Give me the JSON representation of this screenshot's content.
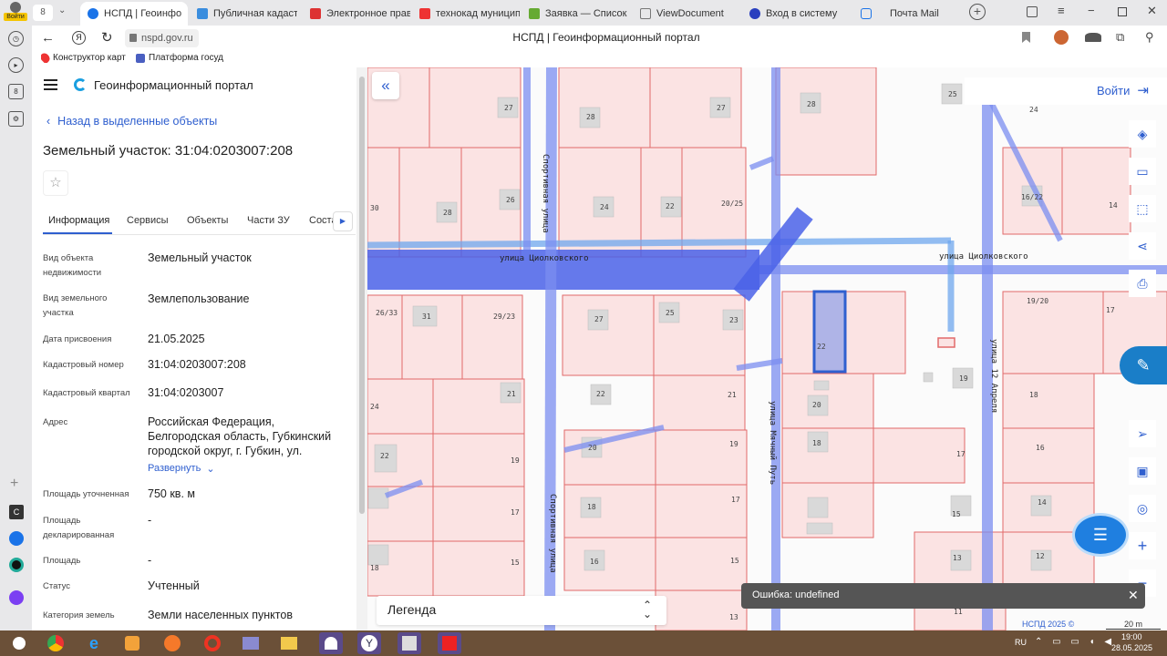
{
  "browser": {
    "tabs": [
      {
        "label": "НСПД | Геоинфо",
        "color": "#1a73e8"
      },
      {
        "label": "Публичная кадастр",
        "color": "#3a8dde"
      },
      {
        "label": "Электронное прави",
        "color": "#d33"
      },
      {
        "label": "технокад муниципа",
        "color": "#e33"
      },
      {
        "label": "Заявка — Список за",
        "color": "#6a3"
      },
      {
        "label": "ViewDocument",
        "color": "#777"
      },
      {
        "label": "Вход в систему",
        "color": "#2a3fbf"
      },
      {
        "label": "Почта Mail",
        "color": "#1a73e8"
      }
    ],
    "first_tab_badge": "8",
    "profile_label": "Войти",
    "url": "nspd.gov.ru",
    "page_title": "НСПД | Геоинформационный портал",
    "bookmarks": [
      "Конструктор карт",
      "Платформа госуд"
    ]
  },
  "sidebar": {
    "badge": "8"
  },
  "panel": {
    "app_title": "Геоинформационный портал",
    "back_link": "Назад в выделенные объекты",
    "object_title": "Земельный участок: 31:04:0203007:208",
    "tabs": [
      "Информация",
      "Сервисы",
      "Объекты",
      "Части ЗУ",
      "Соста"
    ],
    "rows": [
      {
        "label": "Вид объекта недвижимости",
        "value": "Земельный участок"
      },
      {
        "label": "Вид земельного участка",
        "value": "Землепользование"
      },
      {
        "label": "Дата присвоения",
        "value": "21.05.2025"
      },
      {
        "label": "Кадастровый номер",
        "value": "31:04:0203007:208"
      },
      {
        "label": "Кадастровый квартал",
        "value": "31:04:0203007"
      },
      {
        "label": "Адрес",
        "value": "Российская Федерация, Белгородская область, Губкинский городской округ, г. Губкин, ул."
      },
      {
        "label": "Площадь уточненная",
        "value": "750 кв. м"
      },
      {
        "label": "Площадь декларированная",
        "value": "-"
      },
      {
        "label": "Площадь",
        "value": "-"
      },
      {
        "label": "Статус",
        "value": "Учтенный"
      },
      {
        "label": "Категория земель",
        "value": "Земли населенных пунктов"
      }
    ],
    "expand_link": "Развернуть"
  },
  "map": {
    "login_label": "Войти",
    "streets": [
      "улица Циолковского",
      "улица Циолковского",
      "Спортивная улица",
      "Спортивная улица",
      "улица Мячный Путь",
      "улица 12 Апреля"
    ],
    "parcel_numbers": [
      "27",
      "28",
      "27",
      "28",
      "25",
      "24",
      "30",
      "28",
      "26",
      "24",
      "22",
      "20/25",
      "16/22",
      "14",
      "26/33",
      "31",
      "29/23",
      "27",
      "25",
      "23",
      "22",
      "19/20",
      "17",
      "24",
      "21",
      "22",
      "21",
      "20",
      "19",
      "18",
      "22",
      "19",
      "20",
      "19",
      "18",
      "17",
      "16",
      "17",
      "18",
      "17",
      "15",
      "14",
      "18",
      "15",
      "16",
      "15",
      "13",
      "12",
      "13",
      "11"
    ],
    "legend_label": "Легенда",
    "error_text": "Ошибка: undefined",
    "footer_brand": "НСПД 2025 ©",
    "scale_label": "20 m"
  },
  "taskbar": {
    "lang": "RU",
    "time": "19:00",
    "date": "28.05.2025"
  }
}
